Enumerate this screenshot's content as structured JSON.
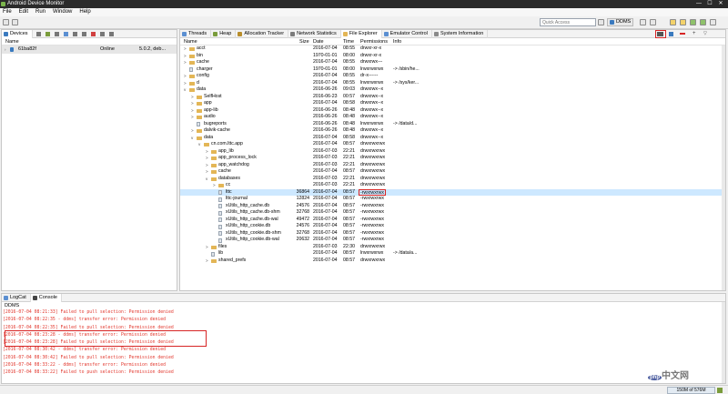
{
  "window": {
    "title": "Android Device Monitor",
    "controls": [
      "—",
      "☐",
      "✕"
    ]
  },
  "menu": [
    "File",
    "Edit",
    "Run",
    "Window",
    "Help"
  ],
  "toolbar": {
    "quick_access_placeholder": "Quick Access",
    "ddms_label": "DDMS"
  },
  "devices_panel": {
    "tab_label": "Devices",
    "column_header": "Name",
    "device": {
      "name": "61ba82f",
      "state": "Online",
      "version": "5.0.2, deb..."
    }
  },
  "main_tabs": [
    {
      "label": "Threads",
      "icon": "threads-icon",
      "color": "#5b8fd1"
    },
    {
      "label": "Heap",
      "icon": "heap-icon",
      "color": "#7a9c3b"
    },
    {
      "label": "Allocation Tracker",
      "icon": "allocation-icon",
      "color": "#b88d2a"
    },
    {
      "label": "Network Statistics",
      "icon": "network-icon",
      "color": "#7b7b7b"
    },
    {
      "label": "File Explorer",
      "icon": "file-explorer-icon",
      "color": "#e3b656"
    },
    {
      "label": "Emulator Control",
      "icon": "emulator-icon",
      "color": "#5b8fd1"
    },
    {
      "label": "System Information",
      "icon": "sysinfo-icon",
      "color": "#8a8a8a"
    }
  ],
  "file_explorer": {
    "columns": [
      "Name",
      "Size",
      "Date",
      "Time",
      "Permissions",
      "Info"
    ],
    "rows": [
      {
        "depth": 0,
        "arrow": ">",
        "type": "folder",
        "name": "acct",
        "size": "",
        "date": "2016-07-04",
        "time": "08:55",
        "perm": "drwxr-xr-x",
        "info": ""
      },
      {
        "depth": 0,
        "arrow": ">",
        "type": "folder",
        "name": "bin",
        "size": "",
        "date": "1970-01-01",
        "time": "08:00",
        "perm": "drwxr-xr-x",
        "info": ""
      },
      {
        "depth": 0,
        "arrow": ">",
        "type": "folder",
        "name": "cache",
        "size": "",
        "date": "2016-07-04",
        "time": "08:55",
        "perm": "drwxrwx---",
        "info": ""
      },
      {
        "depth": 0,
        "arrow": "",
        "type": "file",
        "name": "charger",
        "size": "",
        "date": "1970-01-01",
        "time": "08:00",
        "perm": "lrwxrwxrwx",
        "info": "-> /sbin/he..."
      },
      {
        "depth": 0,
        "arrow": ">",
        "type": "folder",
        "name": "config",
        "size": "",
        "date": "2016-07-04",
        "time": "08:55",
        "perm": "dr-x------",
        "info": ""
      },
      {
        "depth": 0,
        "arrow": ">",
        "type": "folder",
        "name": "d",
        "size": "",
        "date": "2016-07-04",
        "time": "08:55",
        "perm": "lrwxrwxrwx",
        "info": "-> /sys/ker..."
      },
      {
        "depth": 0,
        "arrow": "v",
        "type": "folder",
        "name": "data",
        "size": "",
        "date": "2016-06-26",
        "time": "09:03",
        "perm": "drwxrwx--x",
        "info": ""
      },
      {
        "depth": 1,
        "arrow": ">",
        "type": "folder",
        "name": "SelfHost",
        "size": "",
        "date": "2016-06-23",
        "time": "00:57",
        "perm": "drwxrwx--x",
        "info": ""
      },
      {
        "depth": 1,
        "arrow": ">",
        "type": "folder",
        "name": "app",
        "size": "",
        "date": "2016-07-04",
        "time": "08:58",
        "perm": "drwxrwx--x",
        "info": ""
      },
      {
        "depth": 1,
        "arrow": ">",
        "type": "folder",
        "name": "app-lib",
        "size": "",
        "date": "2016-06-26",
        "time": "08:48",
        "perm": "drwxrwx--x",
        "info": ""
      },
      {
        "depth": 1,
        "arrow": ">",
        "type": "folder",
        "name": "audio",
        "size": "",
        "date": "2016-06-26",
        "time": "08:48",
        "perm": "drwxrwx--x",
        "info": ""
      },
      {
        "depth": 1,
        "arrow": "",
        "type": "file",
        "name": "bugreports",
        "size": "",
        "date": "2016-06-26",
        "time": "08:48",
        "perm": "lrwxrwxrwx",
        "info": "-> /data/d..."
      },
      {
        "depth": 1,
        "arrow": ">",
        "type": "folder",
        "name": "dalvik-cache",
        "size": "",
        "date": "2016-06-26",
        "time": "08:48",
        "perm": "drwxrwx--x",
        "info": ""
      },
      {
        "depth": 1,
        "arrow": "v",
        "type": "folder",
        "name": "data",
        "size": "",
        "date": "2016-07-04",
        "time": "08:58",
        "perm": "drwxrwx--x",
        "info": ""
      },
      {
        "depth": 2,
        "arrow": "v",
        "type": "folder",
        "name": "cn.com.lttc.app",
        "size": "",
        "date": "2016-07-04",
        "time": "08:57",
        "perm": "drwxrwxrwx",
        "info": ""
      },
      {
        "depth": 3,
        "arrow": ">",
        "type": "folder",
        "name": "app_lib",
        "size": "",
        "date": "2016-07-03",
        "time": "22:21",
        "perm": "drwxrwxrwx",
        "info": ""
      },
      {
        "depth": 3,
        "arrow": ">",
        "type": "folder",
        "name": "app_process_lock",
        "size": "",
        "date": "2016-07-03",
        "time": "22:21",
        "perm": "drwxrwxrwx",
        "info": ""
      },
      {
        "depth": 3,
        "arrow": ">",
        "type": "folder",
        "name": "app_watchdog",
        "size": "",
        "date": "2016-07-03",
        "time": "22:21",
        "perm": "drwxrwxrwx",
        "info": ""
      },
      {
        "depth": 3,
        "arrow": ">",
        "type": "folder",
        "name": "cache",
        "size": "",
        "date": "2016-07-04",
        "time": "08:57",
        "perm": "drwxrwxrwx",
        "info": ""
      },
      {
        "depth": 3,
        "arrow": "v",
        "type": "folder",
        "name": "databases",
        "size": "",
        "date": "2016-07-03",
        "time": "22:21",
        "perm": "drwxrwxrwx",
        "info": ""
      },
      {
        "depth": 4,
        "arrow": ">",
        "type": "folder",
        "name": "cc",
        "size": "",
        "date": "2016-07-03",
        "time": "22:21",
        "perm": "drwxrwxrwx",
        "info": ""
      },
      {
        "depth": 4,
        "arrow": "",
        "type": "file",
        "name": "lttc",
        "size": "36864",
        "date": "2016-07-04",
        "time": "08:57",
        "perm": "-rwxrwxrwx",
        "info": "",
        "selected": true,
        "perm_highlight": true
      },
      {
        "depth": 4,
        "arrow": "",
        "type": "file",
        "name": "lttc-journal",
        "size": "12824",
        "date": "2016-07-04",
        "time": "08:57",
        "perm": "-rwxrwxrwx",
        "info": ""
      },
      {
        "depth": 4,
        "arrow": "",
        "type": "file",
        "name": "xUtils_http_cache.db",
        "size": "24576",
        "date": "2016-07-04",
        "time": "08:57",
        "perm": "-rwxrwxrwx",
        "info": ""
      },
      {
        "depth": 4,
        "arrow": "",
        "type": "file",
        "name": "xUtils_http_cache.db-shm",
        "size": "32768",
        "date": "2016-07-04",
        "time": "08:57",
        "perm": "-rwxrwxrwx",
        "info": ""
      },
      {
        "depth": 4,
        "arrow": "",
        "type": "file",
        "name": "xUtils_http_cache.db-wal",
        "size": "49472",
        "date": "2016-07-04",
        "time": "08:57",
        "perm": "-rwxrwxrwx",
        "info": ""
      },
      {
        "depth": 4,
        "arrow": "",
        "type": "file",
        "name": "xUtils_http_cookie.db",
        "size": "24576",
        "date": "2016-07-04",
        "time": "08:57",
        "perm": "-rwxrwxrwx",
        "info": ""
      },
      {
        "depth": 4,
        "arrow": "",
        "type": "file",
        "name": "xUtils_http_cookie.db-shm",
        "size": "32768",
        "date": "2016-07-04",
        "time": "08:57",
        "perm": "-rwxrwxrwx",
        "info": ""
      },
      {
        "depth": 4,
        "arrow": "",
        "type": "file",
        "name": "xUtils_http_cookie.db-wal",
        "size": "20632",
        "date": "2016-07-04",
        "time": "08:57",
        "perm": "-rwxrwxrwx",
        "info": ""
      },
      {
        "depth": 3,
        "arrow": ">",
        "type": "folder",
        "name": "files",
        "size": "",
        "date": "2016-07-03",
        "time": "22:30",
        "perm": "drwxrwxrwx",
        "info": ""
      },
      {
        "depth": 3,
        "arrow": "",
        "type": "file",
        "name": "lib",
        "size": "",
        "date": "2016-07-04",
        "time": "08:57",
        "perm": "lrwxrwxrwx",
        "info": "-> /data/a..."
      },
      {
        "depth": 3,
        "arrow": ">",
        "type": "folder",
        "name": "shared_prefs",
        "size": "",
        "date": "2016-07-04",
        "time": "08:57",
        "perm": "drwxrwxrwx",
        "info": ""
      }
    ]
  },
  "console_panel": {
    "tabs": [
      "LogCat",
      "Console"
    ],
    "title": "DDMS",
    "lines": [
      "[2016-07-04 08:21:33] Failed to pull selection: Permission denied",
      "[2016-07-04 08:22:35 - ddms] transfer error: Permission denied",
      "[2016-07-04 08:22:35] Failed to pull selection: Permission denied",
      "[2016-07-04 08:23:28 - ddms] transfer error: Permission denied",
      "[2016-07-04 08:23:28] Failed to pull selection: Permission denied",
      "[2016-07-04 08:30:42 - ddms] transfer error: Permission denied",
      "[2016-07-04 08:30:42] Failed to pull selection: Permission denied",
      "[2016-07-04 08:33:22 - ddms] transfer error: Permission denied",
      "[2016-07-04 08:33:22] Failed to push selection: Permission denied"
    ]
  },
  "status": {
    "heap": "150M of 576M"
  },
  "watermark": {
    "badge": "php",
    "text": "中文网"
  }
}
